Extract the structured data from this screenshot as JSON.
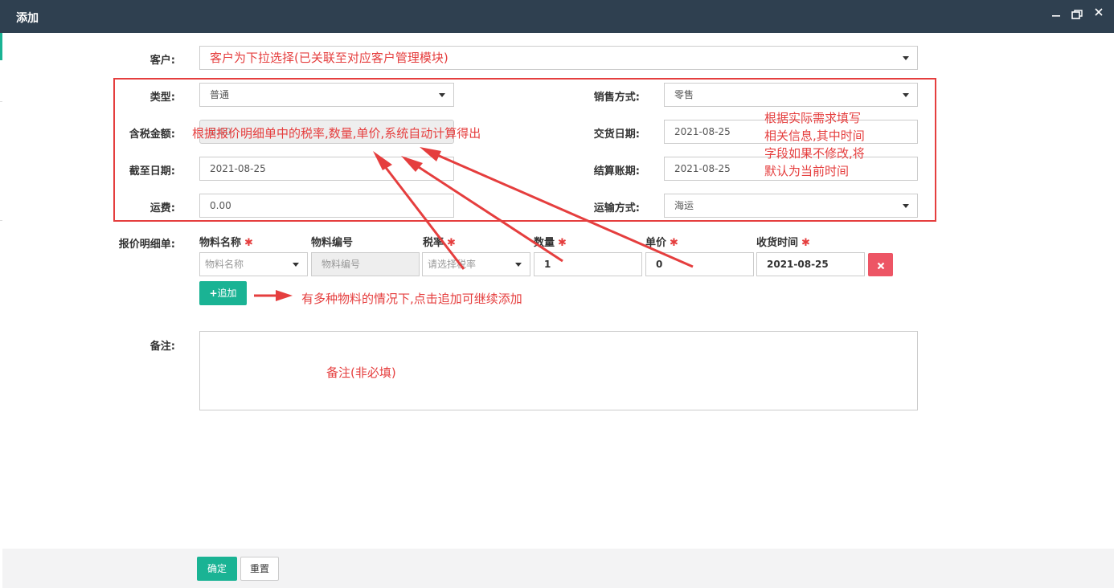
{
  "window": {
    "title": "添加"
  },
  "form": {
    "customer": {
      "label": "客户:",
      "value": "客户为下拉选择(已关联至对应客户管理模块)"
    },
    "type": {
      "label": "类型:",
      "value": "普通"
    },
    "sale_mode": {
      "label": "销售方式:",
      "value": "零售"
    },
    "tax_amount": {
      "label": "含税金额:",
      "value": "0.00"
    },
    "delivery_date": {
      "label": "交货日期:",
      "value": "2021-08-25"
    },
    "cutoff_date": {
      "label": "截至日期:",
      "value": "2021-08-25"
    },
    "settle_period": {
      "label": "结算账期:",
      "value": "2021-08-25"
    },
    "freight": {
      "label": "运费:",
      "value": "0.00"
    },
    "transport": {
      "label": "运输方式:",
      "value": "海运"
    },
    "detail": {
      "label": "报价明细单:",
      "columns": [
        "物料名称",
        "物料编号",
        "税率",
        "数量",
        "单价",
        "收货时间"
      ],
      "required": "✱",
      "row": {
        "material_name_placeholder": "物料名称",
        "material_code_placeholder": "物料编号",
        "tax_rate_placeholder": "请选择税率",
        "quantity": "1",
        "price": "0",
        "receive_time": "2021-08-25"
      },
      "add_label": "追加"
    },
    "remark": {
      "label": "备注:"
    }
  },
  "annotations": {
    "tax_calc": "根据报价明细单中的税率,数量,单价,系统自动计算得出",
    "fill_info": [
      "根据实际需求填写",
      "相关信息,其中时间",
      "字段如果不修改,将",
      "默认为当前时间"
    ],
    "add_more": "有多种物料的情况下,点击追加可继续添加",
    "remark_note": "备注(非必填)"
  },
  "footer": {
    "confirm_label": "确定",
    "reset_label": "重置"
  },
  "colors": {
    "titlebar": "#2f4050",
    "primary": "#1ab394",
    "danger": "#ed5565",
    "annotation": "#e53e3e"
  },
  "icons": [
    "minimize-icon",
    "restore-icon",
    "plus-icon",
    "times-icon",
    "caret-down-icon"
  ]
}
